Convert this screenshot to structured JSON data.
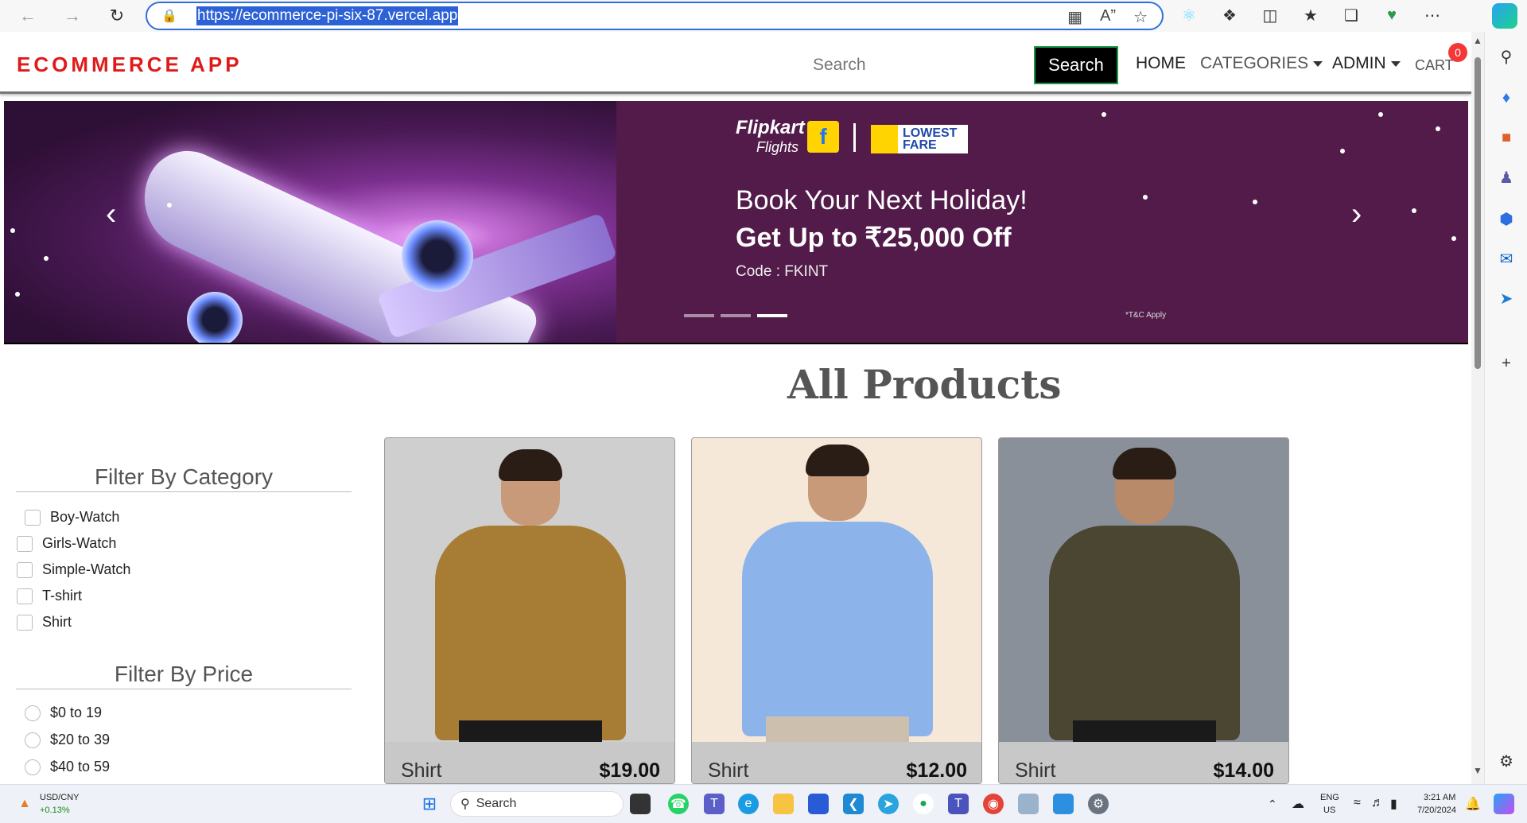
{
  "browser": {
    "url": "https://ecommerce-pi-six-87.vercel.app"
  },
  "navbar": {
    "brand": "ECOMMERCE APP",
    "search_placeholder": "Search",
    "search_button": "Search",
    "home": "HOME",
    "categories": "CATEGORIES",
    "admin": "ADMIN",
    "cart": "CART",
    "cart_count": "0"
  },
  "banner": {
    "brand_line1": "Flipkart",
    "brand_line2": "Flights",
    "fare_tag": "LOWEST FARE",
    "headline1": "Book Your Next Holiday!",
    "headline2": "Get Up to ₹25,000 Off",
    "code": "Code : FKINT",
    "tnc": "*T&C Apply",
    "active_slide": 3,
    "slide_count": 3
  },
  "page_title": "All Products",
  "filters": {
    "category_title": "Filter By Category",
    "categories": [
      "Boy-Watch",
      "Girls-Watch",
      "Simple-Watch",
      "T-shirt",
      "Shirt"
    ],
    "price_title": "Filter By Price",
    "prices": [
      "$0 to 19",
      "$20 to 39",
      "$40 to 59"
    ]
  },
  "products": [
    {
      "name": "Shirt",
      "price": "$19.00",
      "color": "#a77d35",
      "bg": "#cfcfcf"
    },
    {
      "name": "Shirt",
      "price": "$12.00",
      "color": "#8db4ea",
      "bg": "#f6e8d9"
    },
    {
      "name": "Shirt",
      "price": "$14.00",
      "color": "#4a4632",
      "bg": "#8a9099"
    }
  ],
  "taskbar": {
    "ticker": "USD/CNY",
    "ticker_change": "+0.13%",
    "search": "Search",
    "lang1": "ENG",
    "lang2": "US",
    "time": "3:21 AM",
    "date": "7/20/2024"
  }
}
